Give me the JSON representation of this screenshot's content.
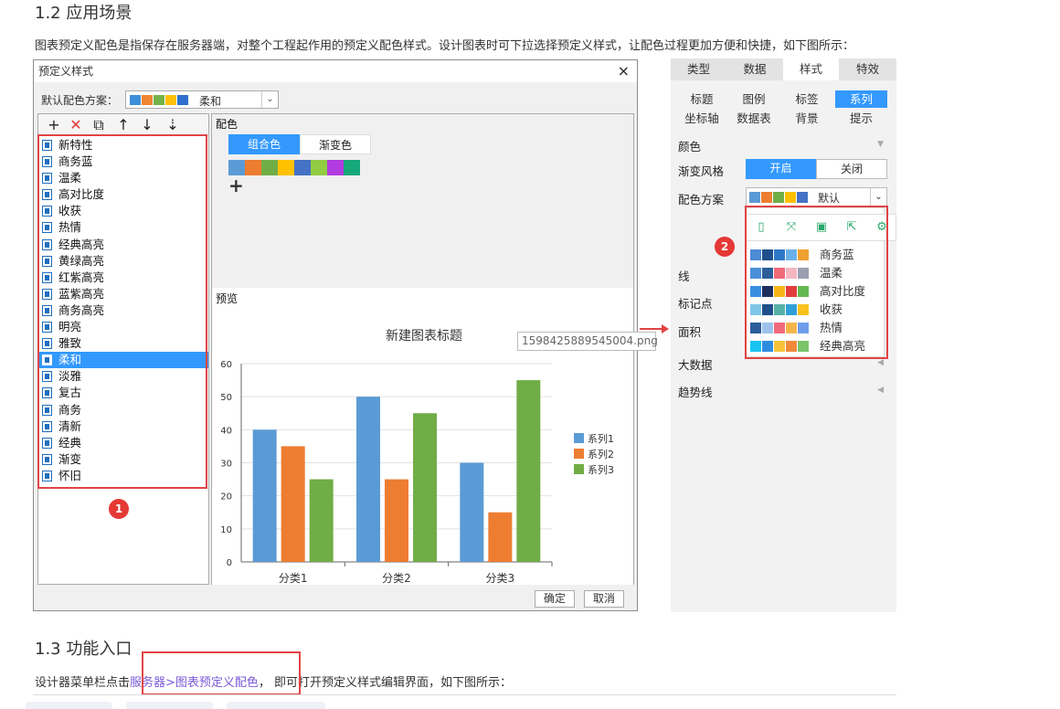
{
  "section12": {
    "heading": "1.2 应用场景",
    "text": "图表预定义配色是指保存在服务器端，对整个工程起作用的预定义配色样式。设计图表时可下拉选择预定义样式，让配色过程更加方便和快捷，如下图所示："
  },
  "dialog": {
    "title": "预定义样式",
    "close": "×",
    "scheme_label": "默认配色方案：",
    "scheme_value": "柔和",
    "scheme_colors": [
      "#3c8fd8",
      "#f08634",
      "#73b34a",
      "#ffc107",
      "#2f6fce"
    ],
    "toolbar": [
      "+",
      "✕",
      "⧉",
      "↑",
      "↓",
      "⇣"
    ],
    "items": [
      "新特性",
      "商务蓝",
      "温柔",
      "高对比度",
      "收获",
      "热情",
      "经典高亮",
      "黄绿高亮",
      "红紫高亮",
      "蓝紫高亮",
      "商务高亮",
      "明亮",
      "雅致",
      "柔和",
      "淡雅",
      "复古",
      "商务",
      "清新",
      "经典",
      "渐变",
      "怀旧"
    ],
    "selected_item": "柔和",
    "color_title": "配色",
    "tab_combo": "组合色",
    "tab_gradient": "渐变色",
    "palette": [
      "#5b9bd5",
      "#ed7d31",
      "#70ad47",
      "#ffc000",
      "#4472c4",
      "#91cc42",
      "#b13ce0",
      "#17a87a"
    ],
    "add": "+",
    "preview_title": "预览",
    "ok": "确定",
    "cancel": "取消",
    "badge": "1"
  },
  "chart_data": {
    "type": "bar",
    "title": "新建图表标题",
    "categories": [
      "分类1",
      "分类2",
      "分类3"
    ],
    "series": [
      {
        "name": "系列1",
        "values": [
          40,
          50,
          30
        ],
        "color": "#5b9bd5"
      },
      {
        "name": "系列2",
        "values": [
          35,
          25,
          15
        ],
        "color": "#ed7d31"
      },
      {
        "name": "系列3",
        "values": [
          25,
          45,
          55
        ],
        "color": "#70ad47"
      }
    ],
    "ylim": [
      0,
      60
    ],
    "yticks": [
      0,
      10,
      20,
      30,
      40,
      50,
      60
    ],
    "grid": true,
    "legend": "right"
  },
  "side": {
    "tabs": [
      "类型",
      "数据",
      "样式",
      "特效"
    ],
    "active_tab": "样式",
    "subtabs": [
      "标题",
      "图例",
      "标签",
      "系列",
      "坐标轴",
      "数据表",
      "背景",
      "提示"
    ],
    "active_subtab": "系列",
    "color_section": "颜色",
    "gradient_label": "渐变风格",
    "on": "开启",
    "off": "关闭",
    "scheme_label": "配色方案",
    "scheme_value": "默认",
    "popup_items": [
      {
        "name": "商务蓝",
        "colors": [
          "#4b8bd4",
          "#1f4f8c",
          "#2f77c7",
          "#6ab0e8",
          "#f0a030"
        ]
      },
      {
        "name": "温柔",
        "colors": [
          "#4a90d9",
          "#2c5e99",
          "#f06a7a",
          "#f4b6c0",
          "#9aa0b0"
        ]
      },
      {
        "name": "高对比度",
        "colors": [
          "#3a8ee0",
          "#1d2f5c",
          "#f6b619",
          "#e23c3c",
          "#64b850"
        ]
      },
      {
        "name": "收获",
        "colors": [
          "#7fc6e8",
          "#1e4f8a",
          "#55b0a6",
          "#2f9fd8",
          "#f8c11d"
        ]
      },
      {
        "name": "热情",
        "colors": [
          "#2b5d9b",
          "#9dc3ec",
          "#f06a7a",
          "#f7b44a",
          "#6d9eeb"
        ]
      },
      {
        "name": "经典高亮",
        "colors": [
          "#19c3f0",
          "#2e8de0",
          "#f8c33a",
          "#f08a3a",
          "#7cc46a"
        ]
      }
    ],
    "sections": [
      "线",
      "标记点",
      "面积",
      "大数据",
      "趋势线"
    ],
    "badge": "2",
    "tooltip": "1598425889545004.png"
  },
  "section13": {
    "heading": "1.3 功能入口",
    "text_before": "设计器菜单栏点击",
    "link": "服务器>图表预定义配色",
    "text_after": "， 即可打开预定义样式编辑界面，如下图所示："
  }
}
